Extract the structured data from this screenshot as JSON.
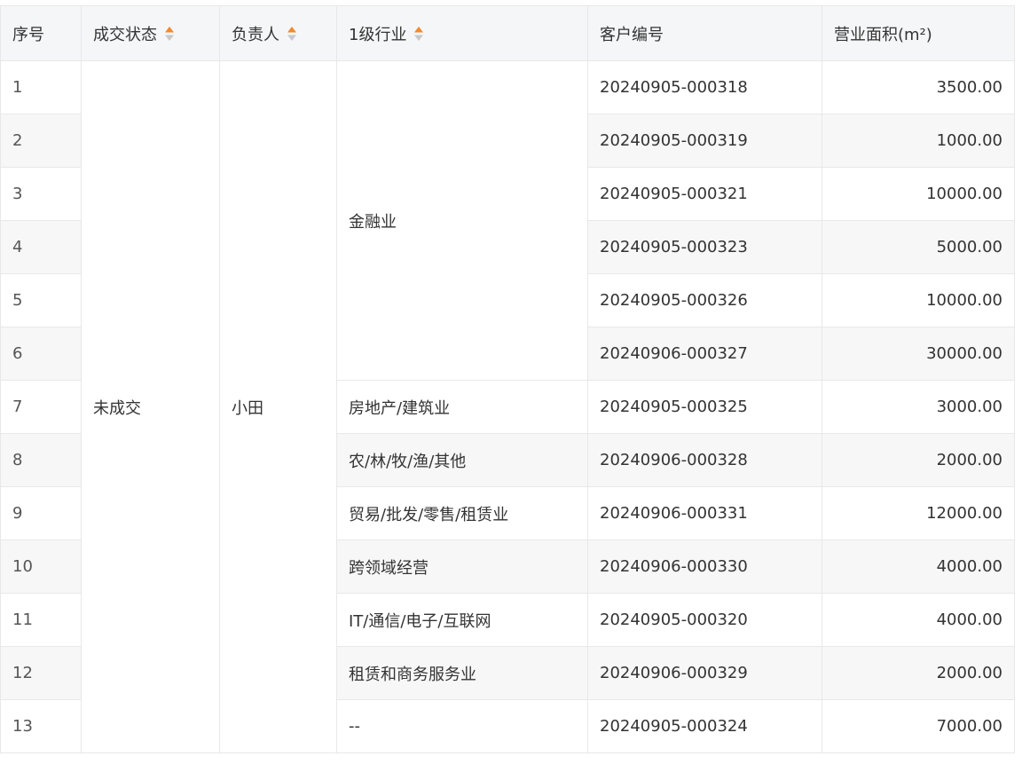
{
  "colors": {
    "sort_up": "#f08a30",
    "sort_down": "#c8c8c8",
    "header_bg": "#f5f6f7",
    "stripe_bg": "#f7f7f7",
    "border": "#e8e8e8"
  },
  "header": {
    "index": "序号",
    "status": "成交状态",
    "owner": "负责人",
    "industry": "1级行业",
    "customer_no": "客户编号",
    "area": "营业面积(m²)"
  },
  "merged": {
    "status": "未成交",
    "owner": "小田"
  },
  "industries": [
    "金融业",
    "房地产/建筑业",
    "农/林/牧/渔/其他",
    "贸易/批发/零售/租赁业",
    "跨领域经营",
    "IT/通信/电子/互联网",
    "租赁和商务服务业",
    "--"
  ],
  "rows": [
    {
      "index": "1",
      "customer_no": "20240905-000318",
      "area": "3500.00"
    },
    {
      "index": "2",
      "customer_no": "20240905-000319",
      "area": "1000.00"
    },
    {
      "index": "3",
      "customer_no": "20240905-000321",
      "area": "10000.00"
    },
    {
      "index": "4",
      "customer_no": "20240905-000323",
      "area": "5000.00"
    },
    {
      "index": "5",
      "customer_no": "20240905-000326",
      "area": "10000.00"
    },
    {
      "index": "6",
      "customer_no": "20240906-000327",
      "area": "30000.00"
    },
    {
      "index": "7",
      "customer_no": "20240905-000325",
      "area": "3000.00"
    },
    {
      "index": "8",
      "customer_no": "20240906-000328",
      "area": "2000.00"
    },
    {
      "index": "9",
      "customer_no": "20240906-000331",
      "area": "12000.00"
    },
    {
      "index": "10",
      "customer_no": "20240906-000330",
      "area": "4000.00"
    },
    {
      "index": "11",
      "customer_no": "20240905-000320",
      "area": "4000.00"
    },
    {
      "index": "12",
      "customer_no": "20240906-000329",
      "area": "2000.00"
    },
    {
      "index": "13",
      "customer_no": "20240905-000324",
      "area": "7000.00"
    }
  ]
}
